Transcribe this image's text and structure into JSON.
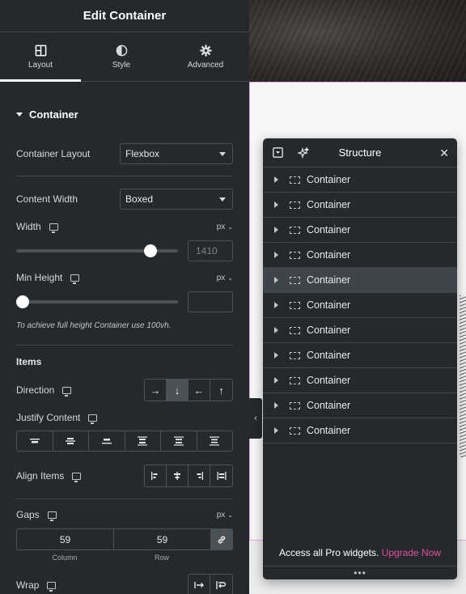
{
  "panel": {
    "title": "Edit Container",
    "tabs": [
      {
        "label": "Layout",
        "icon": "layout-icon",
        "active": true
      },
      {
        "label": "Style",
        "icon": "style-half-circle-icon",
        "active": false
      },
      {
        "label": "Advanced",
        "icon": "gear-icon",
        "active": false
      }
    ],
    "section_title": "Container",
    "container_layout": {
      "label": "Container Layout",
      "value": "Flexbox"
    },
    "content_width": {
      "label": "Content Width",
      "value": "Boxed"
    },
    "width": {
      "label": "Width",
      "unit": "px",
      "value": "",
      "placeholder": "1410",
      "slider_fraction": 0.83
    },
    "min_height": {
      "label": "Min Height",
      "unit": "px",
      "value": "",
      "slider_fraction": 0.0
    },
    "hint": "To achieve full height Container use 100vh.",
    "items_heading": "Items",
    "direction": {
      "label": "Direction",
      "options": [
        "→",
        "↓",
        "←",
        "↑"
      ],
      "selected": 1
    },
    "justify_content": {
      "label": "Justify Content"
    },
    "align_items": {
      "label": "Align Items"
    },
    "gaps": {
      "label": "Gaps",
      "unit": "px",
      "column": "59",
      "row": "59",
      "column_label": "Column",
      "row_label": "Row"
    },
    "wrap": {
      "label": "Wrap"
    }
  },
  "structure": {
    "title": "Structure",
    "items": [
      "Container",
      "Container",
      "Container",
      "Container",
      "Container",
      "Container",
      "Container",
      "Container",
      "Container",
      "Container",
      "Container"
    ],
    "highlighted_index": 4,
    "promo_text": "Access all Pro widgets.",
    "promo_link": "Upgrade Now",
    "accent": "#e24e9f"
  },
  "colors": {
    "panel_bg": "#26292c",
    "border": "#4c5156",
    "selection_outline": "#e4a6e0"
  }
}
